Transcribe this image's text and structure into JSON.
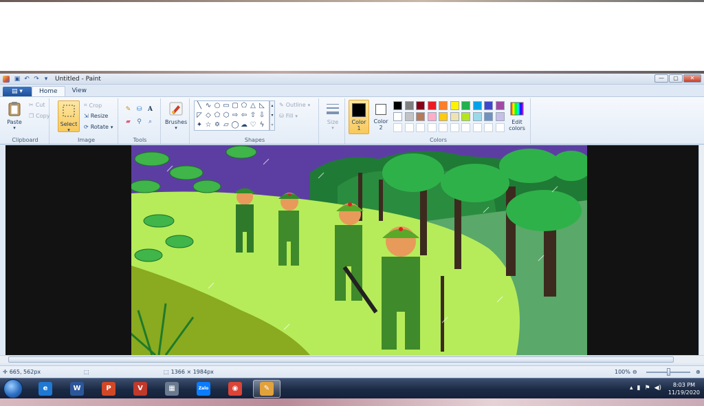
{
  "window": {
    "title": "Untitled - Paint",
    "controls": {
      "minimize": "—",
      "maximize": "▢",
      "close": "✕"
    }
  },
  "tabs": [
    {
      "label": "Home",
      "active": true
    },
    {
      "label": "View",
      "active": false
    }
  ],
  "ribbon": {
    "clipboard": {
      "label": "Clipboard",
      "paste": "Paste",
      "cut": "Cut",
      "copy": "Copy"
    },
    "image": {
      "label": "Image",
      "select": "Select",
      "crop": "Crop",
      "resize": "Resize",
      "rotate": "Rotate"
    },
    "tools": {
      "label": "Tools"
    },
    "brushes": {
      "label": "Brushes"
    },
    "shapes": {
      "label": "Shapes",
      "outline": "Outline",
      "fill": "Fill"
    },
    "size": {
      "label": "Size"
    },
    "colors": {
      "label": "Colors",
      "color1": "Color 1",
      "color1_line1": "Color",
      "color1_line2": "1",
      "color2_line1": "Color",
      "color2_line2": "2",
      "edit_line1": "Edit",
      "edit_line2": "colors",
      "color1_value": "#000000",
      "color2_value": "#ffffff",
      "palette_row1": [
        "#000000",
        "#7f7f7f",
        "#880015",
        "#ed1c24",
        "#ff7f27",
        "#fff200",
        "#22b14c",
        "#00a2e8",
        "#3f48cc",
        "#a349a4"
      ],
      "palette_row2": [
        "#ffffff",
        "#c3c3c3",
        "#b97a57",
        "#ffaec9",
        "#ffc90e",
        "#efe4b0",
        "#b5e61d",
        "#99d9ea",
        "#7092be",
        "#c8bfe7"
      ],
      "palette_row3": [
        "#ffffff",
        "#ffffff",
        "#ffffff",
        "#ffffff",
        "#ffffff",
        "#ffffff",
        "#ffffff",
        "#ffffff",
        "#ffffff",
        "#ffffff"
      ]
    }
  },
  "status": {
    "cursor_position": "665, 562px",
    "image_size": "1366 × 1984px",
    "zoom": "100%"
  },
  "taskbar": {
    "apps": [
      {
        "name": "internet-explorer",
        "glyph": "e",
        "color": "#1f78d1"
      },
      {
        "name": "word",
        "glyph": "W",
        "color": "#2b579a"
      },
      {
        "name": "powerpoint",
        "glyph": "P",
        "color": "#d24726"
      },
      {
        "name": "vietkey",
        "glyph": "V",
        "color": "#c0392b"
      },
      {
        "name": "calculator",
        "glyph": "▦",
        "color": "#6a7b8f"
      },
      {
        "name": "zalo",
        "glyph": "Zalo",
        "color": "#0a7cff"
      },
      {
        "name": "chrome",
        "glyph": "◉",
        "color": "#db4437"
      },
      {
        "name": "paint",
        "glyph": "✎",
        "color": "#e2a23b"
      }
    ],
    "time": "8:03 PM",
    "date": "11/19/2020"
  }
}
